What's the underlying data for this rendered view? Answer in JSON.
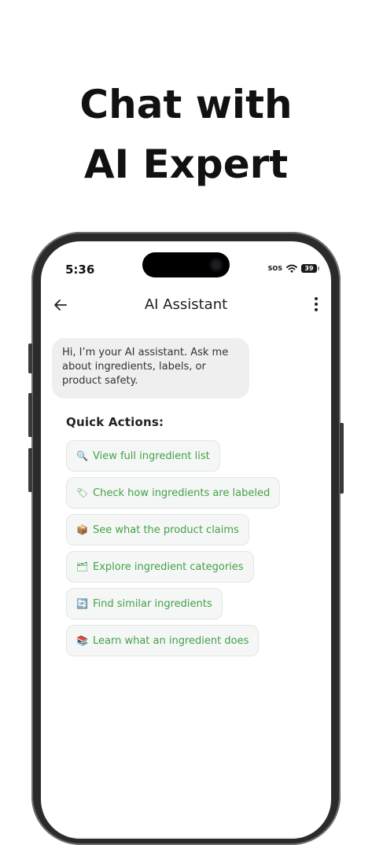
{
  "promo": {
    "headline_line1": "Chat with",
    "headline_line2": "AI Expert"
  },
  "status_bar": {
    "time": "5:36",
    "sos": "SOS",
    "battery": "39"
  },
  "appbar": {
    "title": "AI Assistant",
    "back_icon": "arrow-left-icon",
    "more_icon": "more-vertical-icon"
  },
  "chat": {
    "assistant_message": "Hi, I’m your AI assistant. Ask me about ingredients, labels, or product safety."
  },
  "quick_actions": {
    "title": "Quick Actions:",
    "accent_color": "#43a047",
    "items": [
      {
        "icon": "🔍",
        "label": "View full ingredient list"
      },
      {
        "icon": "🏷",
        "label": "Check how ingredients are labeled"
      },
      {
        "icon": "📦",
        "label": "See what the product claims"
      },
      {
        "icon": "🗂",
        "label": "Explore ingredient categories"
      },
      {
        "icon": "🔄",
        "label": "Find similar ingredients"
      },
      {
        "icon": "📚",
        "label": "Learn what an ingredient does"
      }
    ]
  }
}
